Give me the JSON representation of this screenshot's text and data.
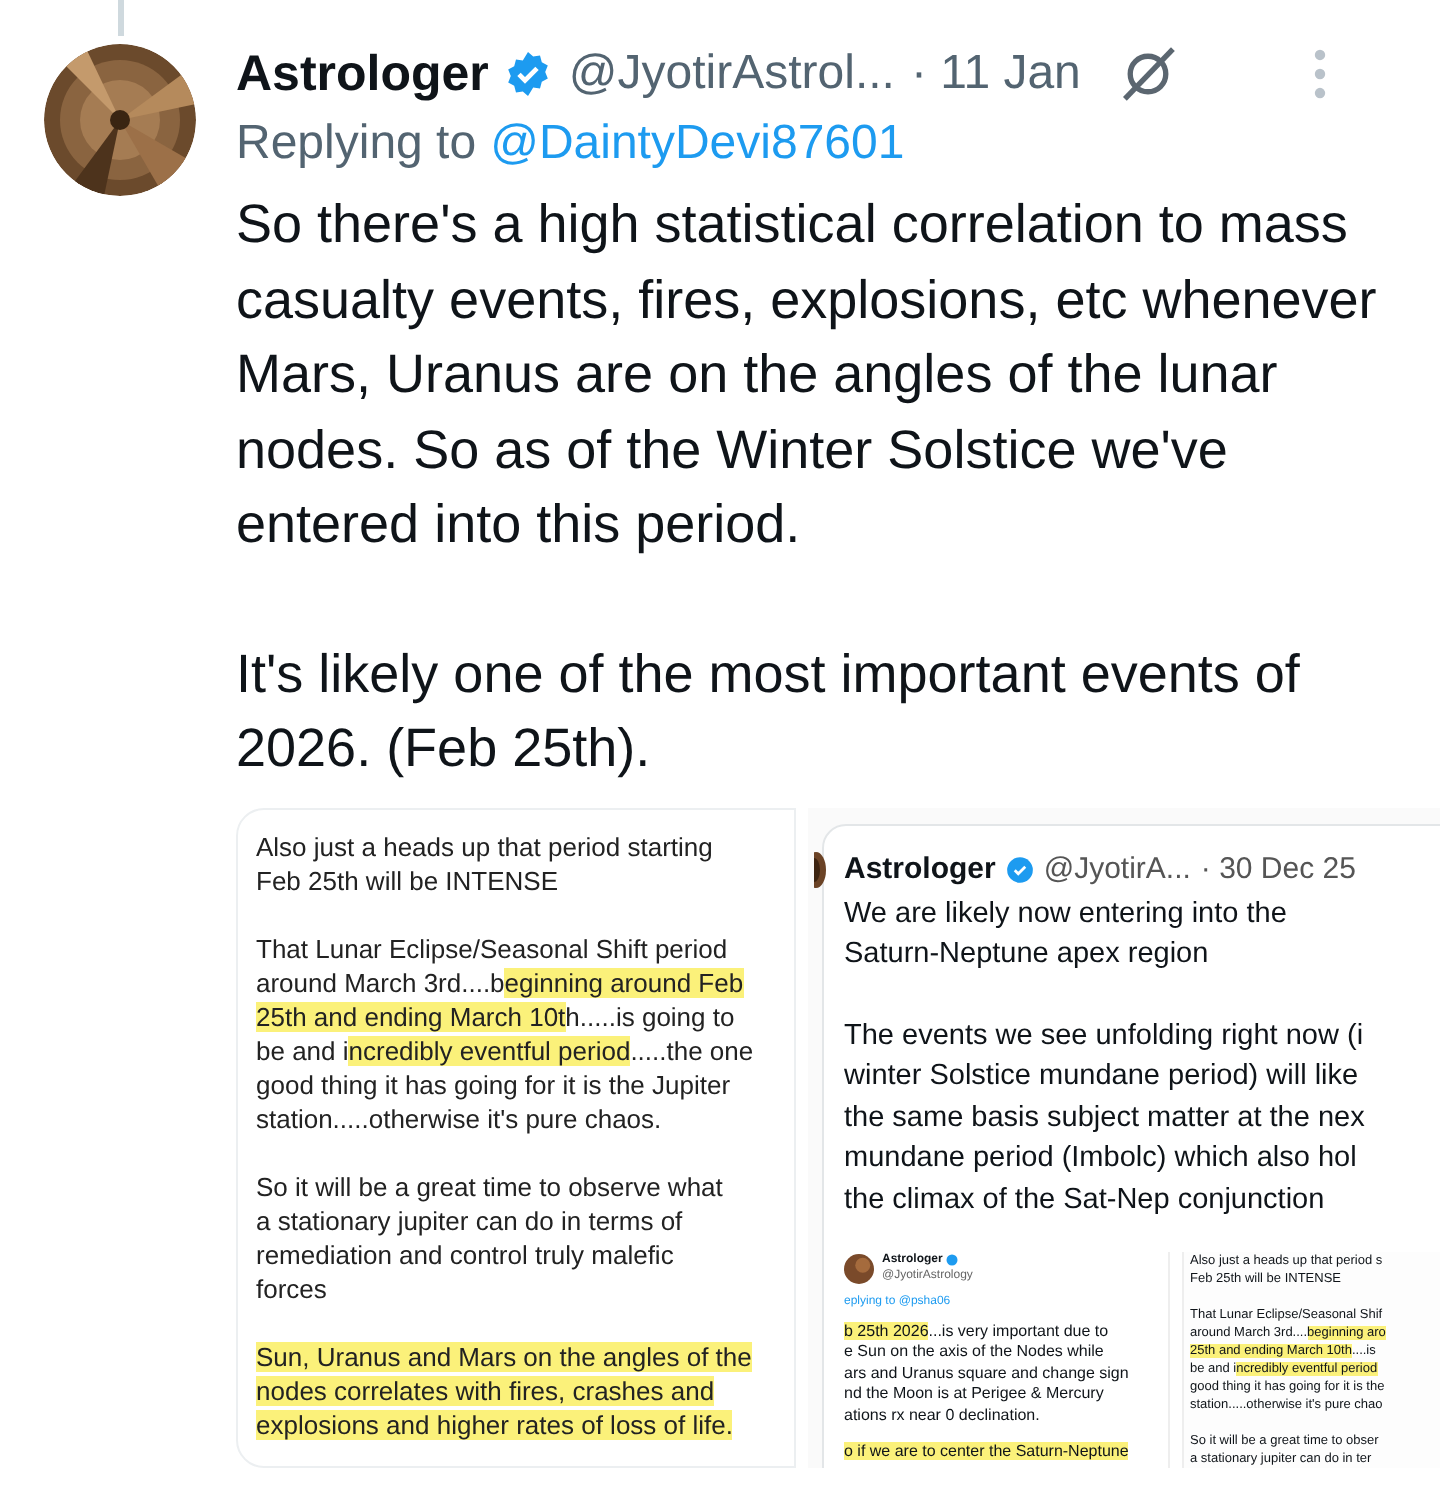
{
  "tweet": {
    "author": "Astrologer",
    "verified": true,
    "handle": "@JyotirAstrol...",
    "time": "· 11 Jan",
    "replying_label": "Replying to",
    "replying_to": "@DaintyDevi87601",
    "paragraphs": [
      "So there's a high statistical correlation to mass casualty events, fires, explosions, etc whenever Mars, Uranus are on the angles of the lunar nodes. So as of the Winter Solstice we've entered into this period.",
      "It's likely one of the most important events of 2026. (Feb 25th)."
    ]
  },
  "media": [
    {
      "kind": "note",
      "paragraphs": [
        [
          [
            {
              "text": "Also just a heads up that period starting",
              "highlighted": false
            }
          ],
          [
            {
              "text": "Feb 25th will be INTENSE",
              "highlighted": false
            }
          ]
        ],
        [
          [
            {
              "text": "That Lunar Eclipse/Seasonal Shift period",
              "highlighted": false
            }
          ],
          [
            {
              "text": "around March 3rd....b",
              "highlighted": false
            },
            {
              "text": "eginning around Feb",
              "highlighted": true
            }
          ],
          [
            {
              "text": "25th and ending March 10t",
              "highlighted": true
            },
            {
              "text": "h.....is going to",
              "highlighted": false
            }
          ],
          [
            {
              "text": "be and i",
              "highlighted": false
            },
            {
              "text": "ncredibly eventful period",
              "highlighted": true
            },
            {
              "text": ".....the one",
              "highlighted": false
            }
          ],
          [
            {
              "text": "good thing it has going for it is the Jupiter",
              "highlighted": false
            }
          ],
          [
            {
              "text": "station.....otherwise it's pure chaos.",
              "highlighted": false
            }
          ]
        ],
        [
          [
            {
              "text": "So it will be a great time to observe what",
              "highlighted": false
            }
          ],
          [
            {
              "text": "a stationary jupiter can do in terms of",
              "highlighted": false
            }
          ],
          [
            {
              "text": "remediation and control truly malefic",
              "highlighted": false
            }
          ],
          [
            {
              "text": "forces",
              "highlighted": false
            }
          ]
        ],
        [
          [
            {
              "text": "Sun, Uranus and Mars on the angles of the",
              "highlighted": true
            }
          ],
          [
            {
              "text": "nodes correlates with fires, crashes and",
              "highlighted": true
            }
          ],
          [
            {
              "text": "explosions and higher rates of loss of life.",
              "highlighted": true
            }
          ]
        ]
      ]
    },
    {
      "kind": "quote",
      "author": "Astrologer",
      "verified": true,
      "handle": "@JyotirA...",
      "time": "· 30 Dec 25",
      "paragraphs": [
        [
          [
            {
              "text": "We are likely now entering into the",
              "highlighted": false
            }
          ],
          [
            {
              "text": "Saturn-Neptune apex region",
              "highlighted": false
            }
          ]
        ],
        [
          [
            {
              "text": "The events we see unfolding right now (i",
              "highlighted": false
            }
          ],
          [
            {
              "text": "winter Solstice mundane period) will like",
              "highlighted": false
            }
          ],
          [
            {
              "text": "the same basis subject matter at the nex",
              "highlighted": false
            }
          ],
          [
            {
              "text": "mundane period (Imbolc) which also hol",
              "highlighted": false
            }
          ],
          [
            {
              "text": "the climax of the Sat-Nep conjunction",
              "highlighted": false
            }
          ]
        ]
      ],
      "images": [
        {
          "kind": "tweet",
          "author": "Astrologer",
          "verified": true,
          "handle": "@JyotirAstrology",
          "replying": "eplying to @psha06",
          "paragraphs": [
            [
              [
                {
                  "text": "b 25th 2026",
                  "highlighted": true
                },
                {
                  "text": "...is very important due to",
                  "highlighted": false
                }
              ],
              [
                {
                  "text": "e Sun on the axis of the Nodes while",
                  "highlighted": false
                }
              ],
              [
                {
                  "text": "ars and Uranus square and change sign",
                  "highlighted": false
                }
              ],
              [
                {
                  "text": "nd the Moon is at Perigee & Mercury",
                  "highlighted": false
                }
              ],
              [
                {
                  "text": "ations rx near 0 declination.",
                  "highlighted": false
                }
              ]
            ],
            [
              [
                {
                  "text": "o if we are to center the Saturn-Neptune",
                  "highlighted": true
                }
              ]
            ]
          ]
        },
        {
          "kind": "note",
          "paragraphs": [
            [
              [
                {
                  "text": "Also just a heads up that period s",
                  "highlighted": false
                }
              ],
              [
                {
                  "text": "Feb 25th will be INTENSE",
                  "highlighted": false
                }
              ]
            ],
            [
              [
                {
                  "text": "That Lunar Eclipse/Seasonal Shif",
                  "highlighted": false
                }
              ],
              [
                {
                  "text": "around March 3rd....",
                  "highlighted": false
                },
                {
                  "text": "beginning aro",
                  "highlighted": true
                }
              ],
              [
                {
                  "text": "25th and ending March 10th",
                  "highlighted": true
                },
                {
                  "text": "....is",
                  "highlighted": false
                }
              ],
              [
                {
                  "text": "be and i",
                  "highlighted": false
                },
                {
                  "text": "ncredibly eventful period",
                  "highlighted": true
                }
              ],
              [
                {
                  "text": "good thing it has going for it is the",
                  "highlighted": false
                }
              ],
              [
                {
                  "text": "station.....otherwise it's pure chao",
                  "highlighted": false
                }
              ]
            ],
            [
              [
                {
                  "text": "So it will be a great time to obser",
                  "highlighted": false
                }
              ],
              [
                {
                  "text": "a stationary jupiter can do in ter",
                  "highlighted": false
                }
              ]
            ]
          ]
        }
      ]
    }
  ]
}
